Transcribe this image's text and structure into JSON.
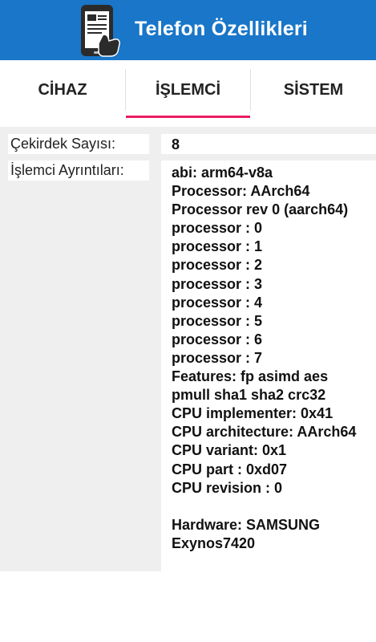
{
  "app": {
    "title": "Telefon Özellikleri"
  },
  "tabs": [
    {
      "label": "CİHAZ",
      "selected": false
    },
    {
      "label": "İŞLEMCİ",
      "selected": true
    },
    {
      "label": "SİSTEM",
      "selected": false
    }
  ],
  "colors": {
    "app_bar": "#1976c8",
    "tab_indicator": "#e91e63",
    "content_background": "#efefef"
  },
  "rows": {
    "cores": {
      "label": "Çekirdek Sayısı:",
      "value": "8"
    },
    "details": {
      "label": "İşlemci Ayrıntıları:",
      "lines": [
        "abi: arm64-v8a",
        "Processor: AArch64",
        "Processor rev 0 (aarch64)",
        "processor : 0",
        "processor : 1",
        "processor : 2",
        "processor : 3",
        "processor : 4",
        "processor : 5",
        "processor : 6",
        "processor : 7",
        "Features: fp asimd aes",
        "pmull sha1 sha2 crc32",
        "CPU implementer: 0x41",
        "CPU architecture: AArch64",
        "CPU variant: 0x1",
        "CPU part : 0xd07",
        "CPU revision : 0",
        "",
        "Hardware: SAMSUNG",
        "Exynos7420"
      ]
    }
  }
}
